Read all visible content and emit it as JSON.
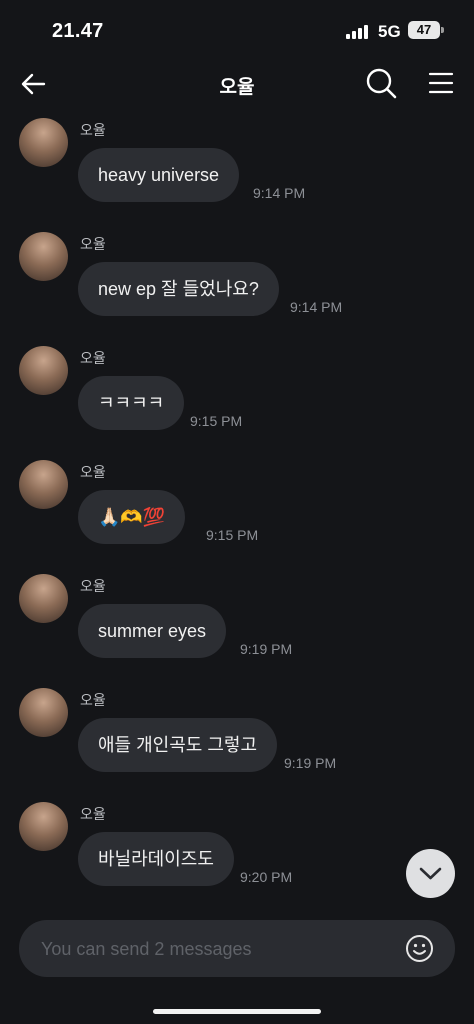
{
  "status_bar": {
    "time": "21.47",
    "network": "5G",
    "battery": "47"
  },
  "header": {
    "title": "오율"
  },
  "messages": [
    {
      "sender": "오율",
      "text": "heavy universe",
      "time": "9:14 PM"
    },
    {
      "sender": "오율",
      "text": "new ep 잘 들었나요?",
      "time": "9:14 PM"
    },
    {
      "sender": "오율",
      "text": "ㅋㅋㅋㅋ",
      "time": "9:15 PM"
    },
    {
      "sender": "오율",
      "text": "🙏🏻🫶💯",
      "time": "9:15 PM"
    },
    {
      "sender": "오율",
      "text": "summer eyes",
      "time": "9:19 PM"
    },
    {
      "sender": "오율",
      "text": "애들 개인곡도 그렇고",
      "time": "9:19 PM"
    },
    {
      "sender": "오율",
      "text": "바닐라데이즈도",
      "time": "9:20 PM"
    }
  ],
  "input": {
    "placeholder": "You can send 2 messages"
  },
  "icons": {
    "back": "arrow-left-icon",
    "search": "search-icon",
    "menu": "hamburger-menu-icon",
    "scroll": "chevron-down-icon",
    "emoji": "smiley-icon"
  },
  "colors": {
    "background": "#141518",
    "bubble": "#2c2e33",
    "timestamp": "#8d9096"
  }
}
